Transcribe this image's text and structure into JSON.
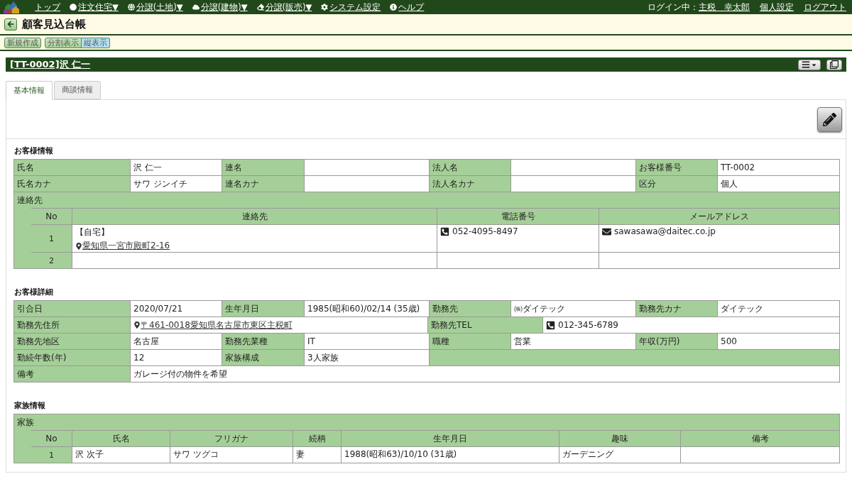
{
  "nav": {
    "items": [
      {
        "label": "トップ"
      },
      {
        "label": "注文住宅▼"
      },
      {
        "label": "分譲(土地)▼"
      },
      {
        "label": "分譲(建物)▼"
      },
      {
        "label": "分譲(販売)▼"
      },
      {
        "label": "システム設定"
      },
      {
        "label": "ヘルプ"
      }
    ],
    "login_prefix": "ログイン中：",
    "user": "主税　幸太郎",
    "links": [
      "個人設定",
      "ログアウト"
    ]
  },
  "page_title": "顧客見込台帳",
  "toolbar": {
    "new_button": "新規作成",
    "views": [
      {
        "label": "分割表示",
        "selected": false
      },
      {
        "label": "縦表示",
        "selected": true
      }
    ]
  },
  "record_title": "[TT-0002]沢 仁一",
  "tabs": [
    {
      "label": "基本情報",
      "selected": true
    },
    {
      "label": "商談情報",
      "selected": false
    }
  ],
  "customer": {
    "title": "お客様情報",
    "rows": [
      {
        "kind": "four",
        "fields": [
          {
            "label": "氏名",
            "value": "沢 仁一"
          },
          {
            "label": "連名"
          },
          {
            "label": "法人名"
          },
          {
            "label": "お客様番号",
            "value": "TT-0002"
          }
        ]
      },
      {
        "kind": "four",
        "fields": [
          {
            "label": "氏名カナ",
            "value": "サワ ジンイチ"
          },
          {
            "label": "連名カナ"
          },
          {
            "label": "法人名カナ"
          },
          {
            "label": "区分",
            "value": "個人"
          }
        ]
      }
    ],
    "contacts": {
      "label": "連絡先",
      "columns": [
        "No",
        "連絡先",
        "電話番号",
        "メールアドレス"
      ],
      "rows": [
        {
          "no": "1",
          "tag": "【自宅】",
          "address": "愛知県一宮市殿町2-16",
          "phone": "052-4095-8497",
          "email": "sawasawa@daitec.co.jp"
        },
        {
          "no": "2"
        }
      ]
    }
  },
  "detail": {
    "title": "お客様詳細",
    "rows": [
      {
        "kind": "four",
        "fields": [
          {
            "label": "引合日",
            "value": "2020/07/21"
          },
          {
            "label": "生年月日",
            "value": "1985(昭和60)/02/14 (35歳)"
          },
          {
            "label": "勤務先",
            "value": "㈱ダイテック"
          },
          {
            "label": "勤務先カナ",
            "value": "ダイテック"
          }
        ]
      },
      {
        "kind": "address_tel",
        "fields": [
          {
            "label": "勤務先住所",
            "address": "〒461-0018愛知県名古屋市東区主税町"
          },
          {
            "label": "勤務先TEL",
            "phone": "012-345-6789"
          }
        ]
      },
      {
        "kind": "four",
        "fields": [
          {
            "label": "勤務先地区",
            "value": "名古屋"
          },
          {
            "label": "勤務先業種",
            "value": "IT"
          },
          {
            "label": "職種",
            "value": "営業"
          },
          {
            "label": "年収(万円)",
            "value": "500"
          }
        ]
      },
      {
        "kind": "two_pairs",
        "fields": [
          {
            "label": "勤続年数(年)",
            "value": "12"
          },
          {
            "label": "家族構成",
            "value": "3人家族"
          }
        ]
      },
      {
        "kind": "wide",
        "fields": [
          {
            "label": "備考",
            "value": "ガレージ付の物件を希望"
          }
        ]
      }
    ]
  },
  "family": {
    "title": "家族情報",
    "label": "家族",
    "columns": [
      "No",
      "氏名",
      "フリガナ",
      "続柄",
      "生年月日",
      "趣味",
      "備考"
    ],
    "rows": [
      {
        "cells": [
          "1",
          "沢 次子",
          "サワ ツグコ",
          "妻",
          "1988(昭和63)/10/10 (31歳)",
          "ガーデニング"
        ]
      }
    ]
  }
}
